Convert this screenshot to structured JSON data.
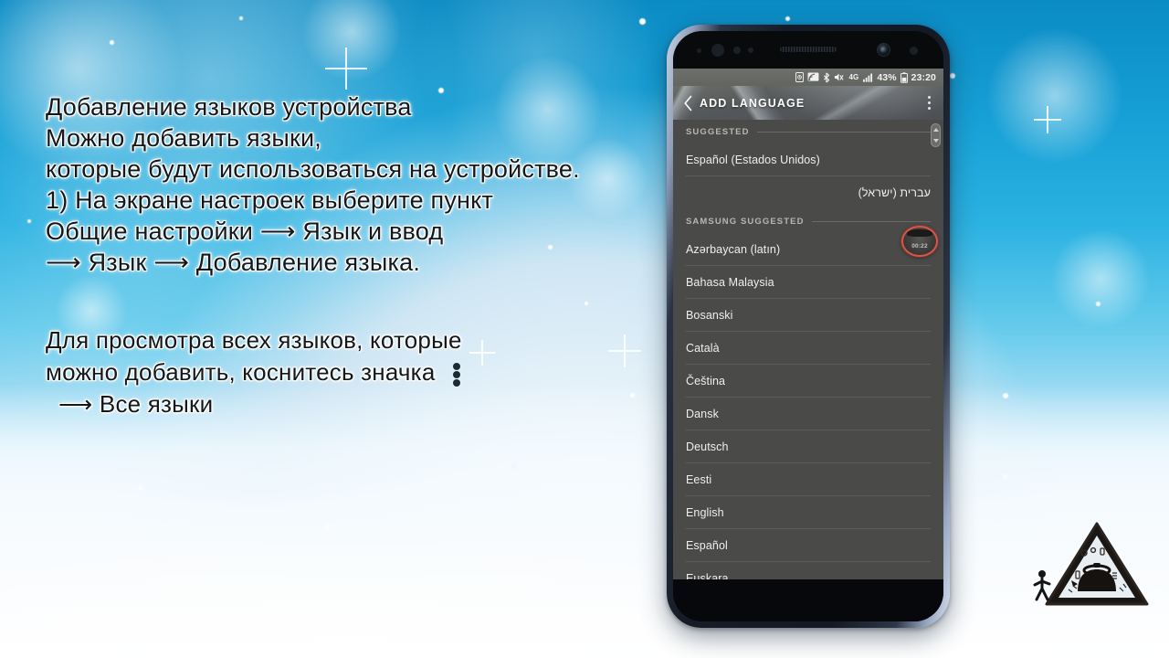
{
  "caption": {
    "lines": [
      "Добавление языков устройства",
      "Можно добавить языки,",
      "которые будут использоваться на устройстве.",
      "1) На экране настроек выберите пункт",
      "Общие настройки ⟶ Язык и ввод",
      "⟶ Язык ⟶ Добавление языка."
    ]
  },
  "caption2": {
    "line1": "Для просмотра всех языков, которые",
    "line2": "можно добавить, коснитесь значка",
    "line3": "⟶ Все языки",
    "icon": "overflow-menu-icon"
  },
  "phone": {
    "status_bar": {
      "icons": [
        "alarm-icon",
        "screen-cast-icon",
        "bluetooth-icon",
        "mute-icon",
        "4g-icon",
        "signal-bars-icon"
      ],
      "network_label": "4G",
      "battery_percent": "43%",
      "battery_icon": "battery-icon",
      "clock": "23:20"
    },
    "app_bar": {
      "back_icon": "back-chevron-icon",
      "title": "ADD LANGUAGE",
      "overflow_icon": "overflow-menu-icon"
    },
    "recorder": {
      "icon": "screen-recorder-icon",
      "elapsed": "00:22"
    },
    "scrollbar": {
      "icon": "scroll-thumb-icon"
    },
    "sections": [
      {
        "header": "SUGGESTED",
        "items": [
          {
            "label": "Español (Estados Unidos)",
            "rtl": false
          },
          {
            "label": "עברית (ישראל)",
            "rtl": true
          }
        ]
      },
      {
        "header": "SAMSUNG SUGGESTED",
        "items": [
          {
            "label": "Azərbaycan (latın)",
            "rtl": false
          },
          {
            "label": "Bahasa Malaysia",
            "rtl": false
          },
          {
            "label": "Bosanski",
            "rtl": false
          },
          {
            "label": "Català",
            "rtl": false
          },
          {
            "label": "Čeština",
            "rtl": false
          },
          {
            "label": "Dansk",
            "rtl": false
          },
          {
            "label": "Deutsch",
            "rtl": false
          },
          {
            "label": "Eesti",
            "rtl": false
          },
          {
            "label": "English",
            "rtl": false
          },
          {
            "label": "Español",
            "rtl": false
          },
          {
            "label": "Euskara",
            "rtl": false
          }
        ]
      }
    ]
  },
  "watermark": {
    "icon": "warning-triangle-kettle-logo",
    "walker_icon": "walking-person-icon"
  },
  "colors": {
    "sky": "#17a0d6",
    "snow": "#ffffff",
    "screen_bg": "#4a4a48",
    "list_text": "#efefef",
    "section_text": "#b6b6b2",
    "divider": "#5d5d5a",
    "recorder_ring": "#d9544a",
    "caption_text": "#15181b"
  }
}
